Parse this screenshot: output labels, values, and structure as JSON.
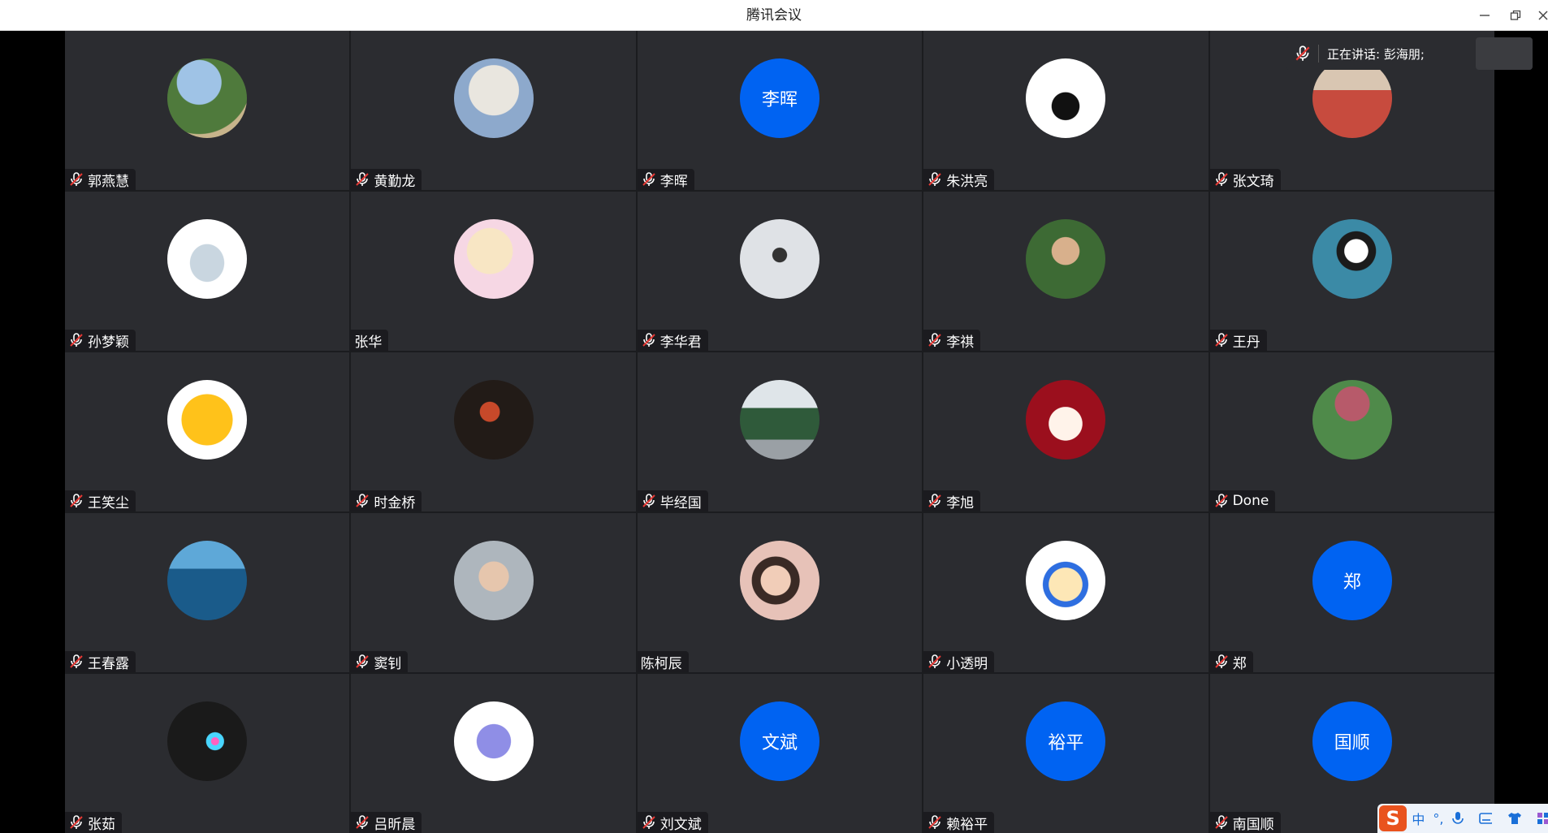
{
  "window": {
    "title": "腾讯会议"
  },
  "speaking_banner": {
    "label": "正在讲话: 彭海朋;"
  },
  "ime": {
    "logo": "S",
    "items": [
      "中",
      "°,",
      "mic-icon",
      "keyboard-icon",
      "shirt-icon",
      "grid-icon"
    ]
  },
  "participants": [
    {
      "name": "郭燕慧",
      "muted": true,
      "avatar": "landscape-photo"
    },
    {
      "name": "黄勤龙",
      "muted": true,
      "avatar": "mosque-photo"
    },
    {
      "name": "李晖",
      "muted": true,
      "avatar_text": "李晖"
    },
    {
      "name": "朱洪亮",
      "muted": true,
      "avatar": "silhouette-photo"
    },
    {
      "name": "张文琦",
      "muted": true,
      "avatar": "person-photo"
    },
    {
      "name": "孙梦颖",
      "muted": true,
      "avatar": "cat-drawing"
    },
    {
      "name": "张华",
      "muted": false,
      "avatar": "anime-girl"
    },
    {
      "name": "李华君",
      "muted": true,
      "avatar": "device-photo"
    },
    {
      "name": "李祺",
      "muted": true,
      "avatar": "child-photo"
    },
    {
      "name": "王丹",
      "muted": true,
      "avatar": "panda-photo"
    },
    {
      "name": "王笑尘",
      "muted": true,
      "avatar": "sun-drawing"
    },
    {
      "name": "时金桥",
      "muted": true,
      "avatar": "night-photo"
    },
    {
      "name": "毕经国",
      "muted": true,
      "avatar": "train-photo"
    },
    {
      "name": "李旭",
      "muted": true,
      "avatar": "anime-red"
    },
    {
      "name": "Done",
      "muted": true,
      "avatar": "umbrella-photo"
    },
    {
      "name": "王春露",
      "muted": true,
      "avatar": "fish-photo"
    },
    {
      "name": "窦钊",
      "muted": true,
      "avatar": "boy-photo"
    },
    {
      "name": "陈柯辰",
      "muted": false,
      "avatar": "girl-photo"
    },
    {
      "name": "小透明",
      "muted": true,
      "avatar": "cartoon-child"
    },
    {
      "name": "郑",
      "muted": true,
      "avatar_text": "郑"
    },
    {
      "name": "张茹",
      "muted": true,
      "avatar": "fiber-photo"
    },
    {
      "name": "吕昕晨",
      "muted": true,
      "avatar": "dolphin-drawing"
    },
    {
      "name": "刘文斌",
      "muted": true,
      "avatar_text": "文斌"
    },
    {
      "name": "赖裕平",
      "muted": true,
      "avatar_text": "裕平"
    },
    {
      "name": "南国顺",
      "muted": true,
      "avatar_text": "国顺"
    }
  ]
}
